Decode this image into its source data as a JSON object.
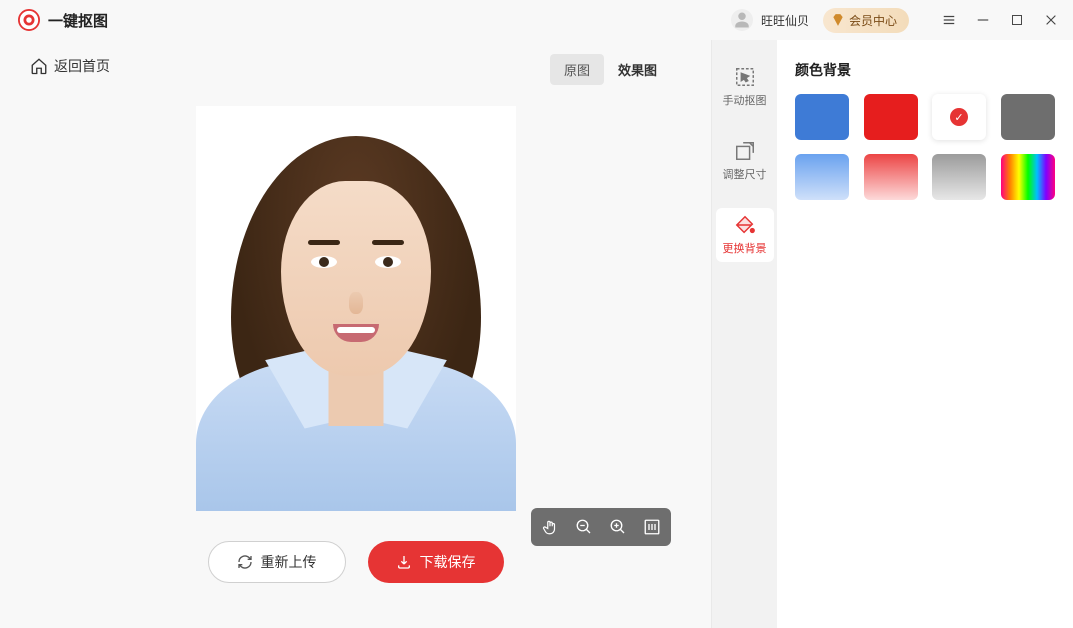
{
  "titlebar": {
    "app_name": "一键抠图",
    "username": "旺旺仙贝",
    "vip_label": "会员中心"
  },
  "toolbar": {
    "back_label": "返回首页"
  },
  "tabs": {
    "original": "原图",
    "result": "效果图"
  },
  "tool_strip": {
    "manual": "手动抠图",
    "resize": "调整尺寸",
    "background": "更换背景"
  },
  "right_panel": {
    "title": "颜色背景",
    "swatches": {
      "blue": "blue",
      "red": "red",
      "white": "white",
      "gray": "gray",
      "blue_grad": "blue-gradient",
      "red_grad": "red-gradient",
      "gray_grad": "gray-gradient",
      "rainbow": "rainbow"
    },
    "selected": "white"
  },
  "action_buttons": {
    "reupload": "重新上传",
    "download": "下载保存"
  }
}
